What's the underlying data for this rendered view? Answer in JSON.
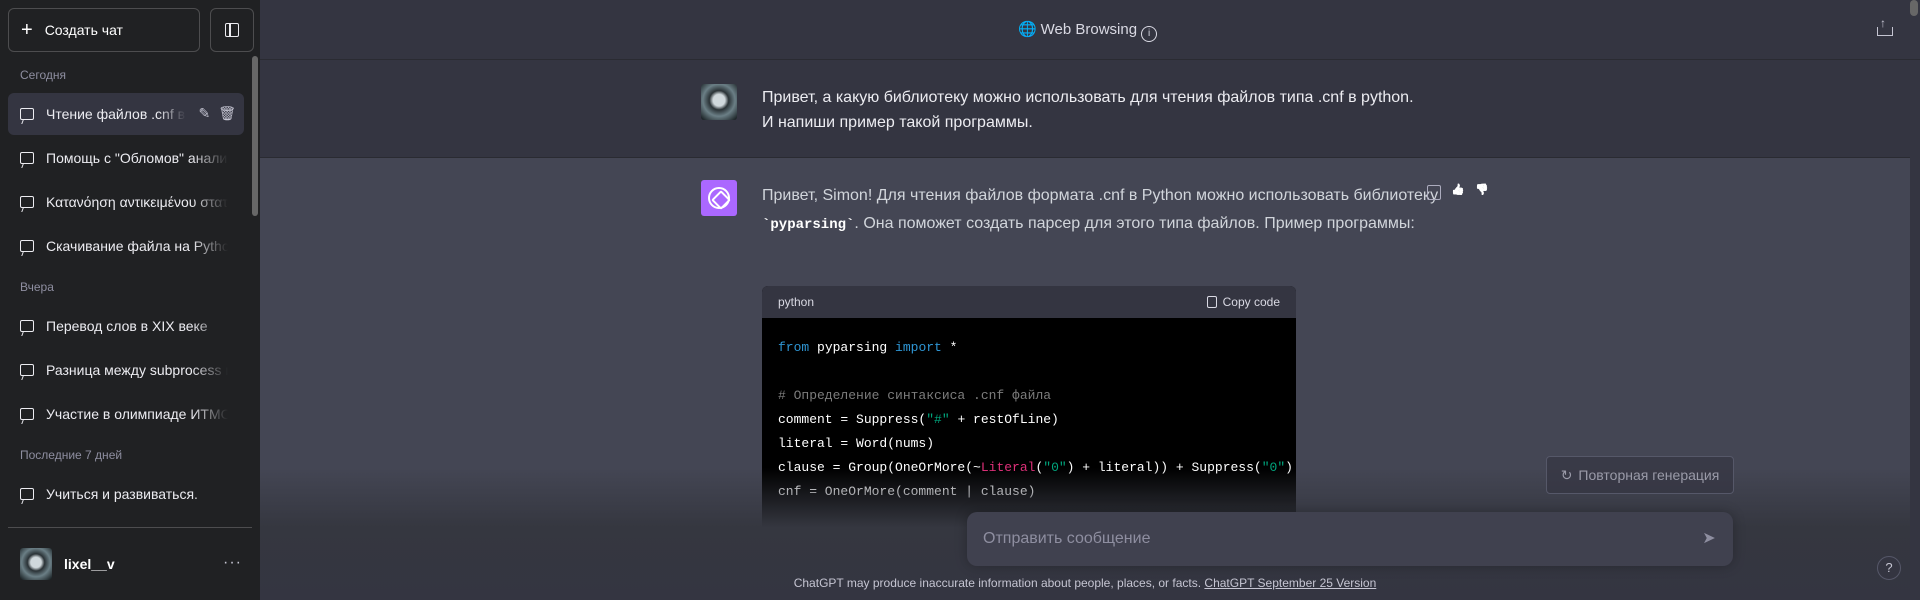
{
  "sidebar": {
    "new_chat_label": "Создать чат",
    "groups": [
      {
        "title": "Сегодня",
        "items": [
          {
            "label": "Чтение файлов .cnf в Python",
            "active": true
          },
          {
            "label": "Помощь с \"Обломов\" анализом"
          },
          {
            "label": "Κατανόηση αντικειμένου στατιστικής"
          },
          {
            "label": "Скачивание файла на Python"
          }
        ]
      },
      {
        "title": "Вчера",
        "items": [
          {
            "label": "Перевод слов в XIX веке"
          },
          {
            "label": "Разница между subprocess и os"
          },
          {
            "label": "Участие в олимпиаде ИТМО"
          }
        ]
      },
      {
        "title": "Последние 7 дней",
        "items": [
          {
            "label": "Учиться и развиваться."
          }
        ]
      }
    ],
    "user": {
      "name": "lixel__v",
      "more": "···"
    }
  },
  "header": {
    "title": "Web Browsing",
    "info_icon": "i"
  },
  "conversation": {
    "user_message_line1": "Привет, а какую библиотеку можно использовать для чтения файлов типа .cnf в python.",
    "user_message_line2": "И напиши пример такой программы.",
    "assistant_intro_before": "Привет, Simon! Для чтения файлов формата .cnf в Python можно использовать библиотеку ",
    "assistant_code_inline": "`pyparsing`",
    "assistant_intro_after": ". Она поможет создать парсер для этого типа файлов. Пример программы:",
    "code_block": {
      "language": "python",
      "copy_label": "Copy code"
    }
  },
  "composer": {
    "regenerate_label": "Повторная генерация",
    "placeholder": "Отправить сообщение",
    "send_icon": "➤"
  },
  "footer": {
    "note": "ChatGPT may produce inaccurate information about people, places, or facts.",
    "link": "ChatGPT September 25 Version"
  },
  "help": "?"
}
